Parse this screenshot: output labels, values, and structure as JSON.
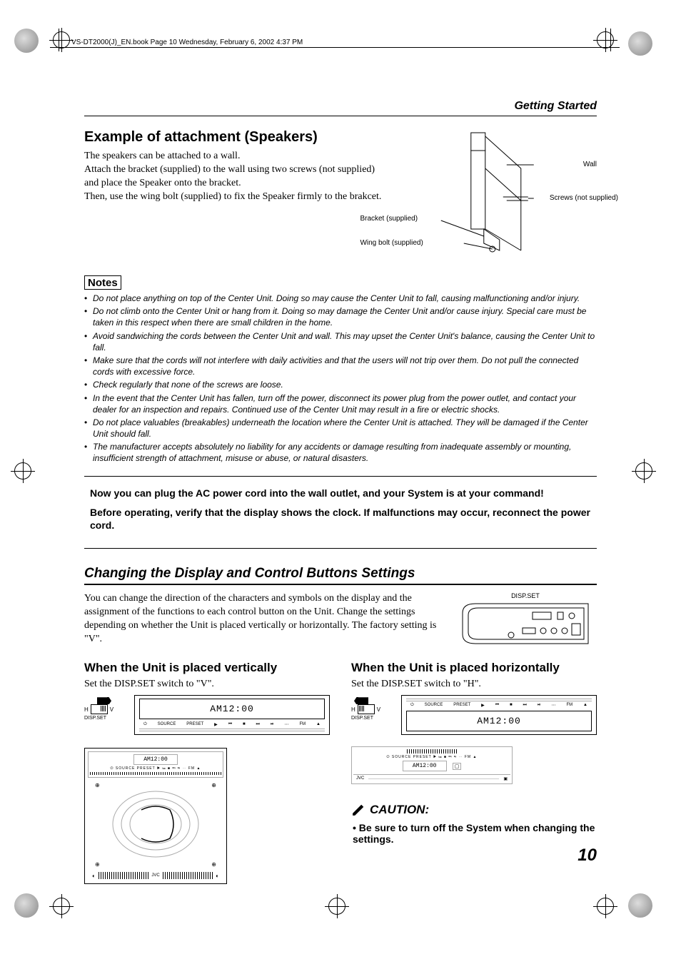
{
  "header_line": "VS-DT2000(J)_EN.book  Page 10  Wednesday, February 6, 2002  4:37 PM",
  "running_title": "Getting Started",
  "attachment": {
    "heading": "Example of attachment (Speakers)",
    "p1": "The speakers can be attached to a wall.",
    "p2": "Attach the bracket (supplied) to the wall using two screws (not supplied) and place the Speaker onto the bracket.",
    "p3": "Then, use the wing bolt (supplied) to fix the Speaker firmly to the brakcet.",
    "labels": {
      "wall": "Wall",
      "screws": "Screws (not supplied)",
      "bracket": "Bracket (supplied)",
      "wingbolt": "Wing bolt (supplied)"
    }
  },
  "notes_label": "Notes",
  "notes": [
    "Do not place anything on top of the Center Unit. Doing so may cause the Center Unit to fall, causing malfunctioning and/or injury.",
    "Do not climb onto the Center Unit or hang from it. Doing so may damage the Center Unit and/or cause injury. Special care must be taken in this respect when there are small children in the home.",
    "Avoid sandwiching the cords between the Center Unit and wall. This may upset the Center Unit's balance, causing the Center Unit to fall.",
    "Make sure that the cords will not interfere with daily activities and that the users will not trip over them. Do not pull the connected cords with excessive force.",
    "Check regularly that none of the screws are loose.",
    "In the event that the Center Unit has fallen, turn off the power, disconnect its power plug from the power outlet, and contact your dealer for an inspection and repairs. Continued use of the Center Unit may result in a fire or electric shocks.",
    "Do not place valuables (breakables) underneath the location where the Center Unit is attached. They will be damaged if the Center Unit should fall.",
    "The manufacturer accepts absolutely no liability for any accidents or damage resulting from inadequate assembly or mounting, insufficient strength of attachment, misuse or abuse, or natural disasters."
  ],
  "now_box": {
    "p1": "Now you can plug the AC power cord into the wall outlet, and your System is at your command!",
    "p2": "Before operating, verify that the display shows the clock. If malfunctions may occur, reconnect the power cord."
  },
  "display_section": {
    "heading": "Changing the Display and Control Buttons Settings",
    "intro": "You can change the direction of the characters and symbols on the display and the assignment of the functions to each control button on the Unit. Change the settings depending on whether the Unit is placed vertically or horizontally. The factory setting is \"V\".",
    "dispset_label": "DISP.SET"
  },
  "vertical": {
    "heading": "When the Unit is placed vertically",
    "text": "Set the DISP.SET switch to \"V\".",
    "switch_h": "H",
    "switch_v": "V",
    "switch_caption": "DISP.SET",
    "display": "AM12:00",
    "mini_display": "AM12:00"
  },
  "horizontal": {
    "heading": "When the Unit is placed horizontally",
    "text": "Set the DISP.SET switch to \"H\".",
    "switch_h": "H",
    "switch_v": "V",
    "switch_caption": "DISP.SET",
    "display": "AM12:00",
    "mini_display": "AM12:00"
  },
  "caution": {
    "heading": "CAUTION:",
    "body": "• Be sure to turn off the System when changing the settings."
  },
  "page_number": "10"
}
